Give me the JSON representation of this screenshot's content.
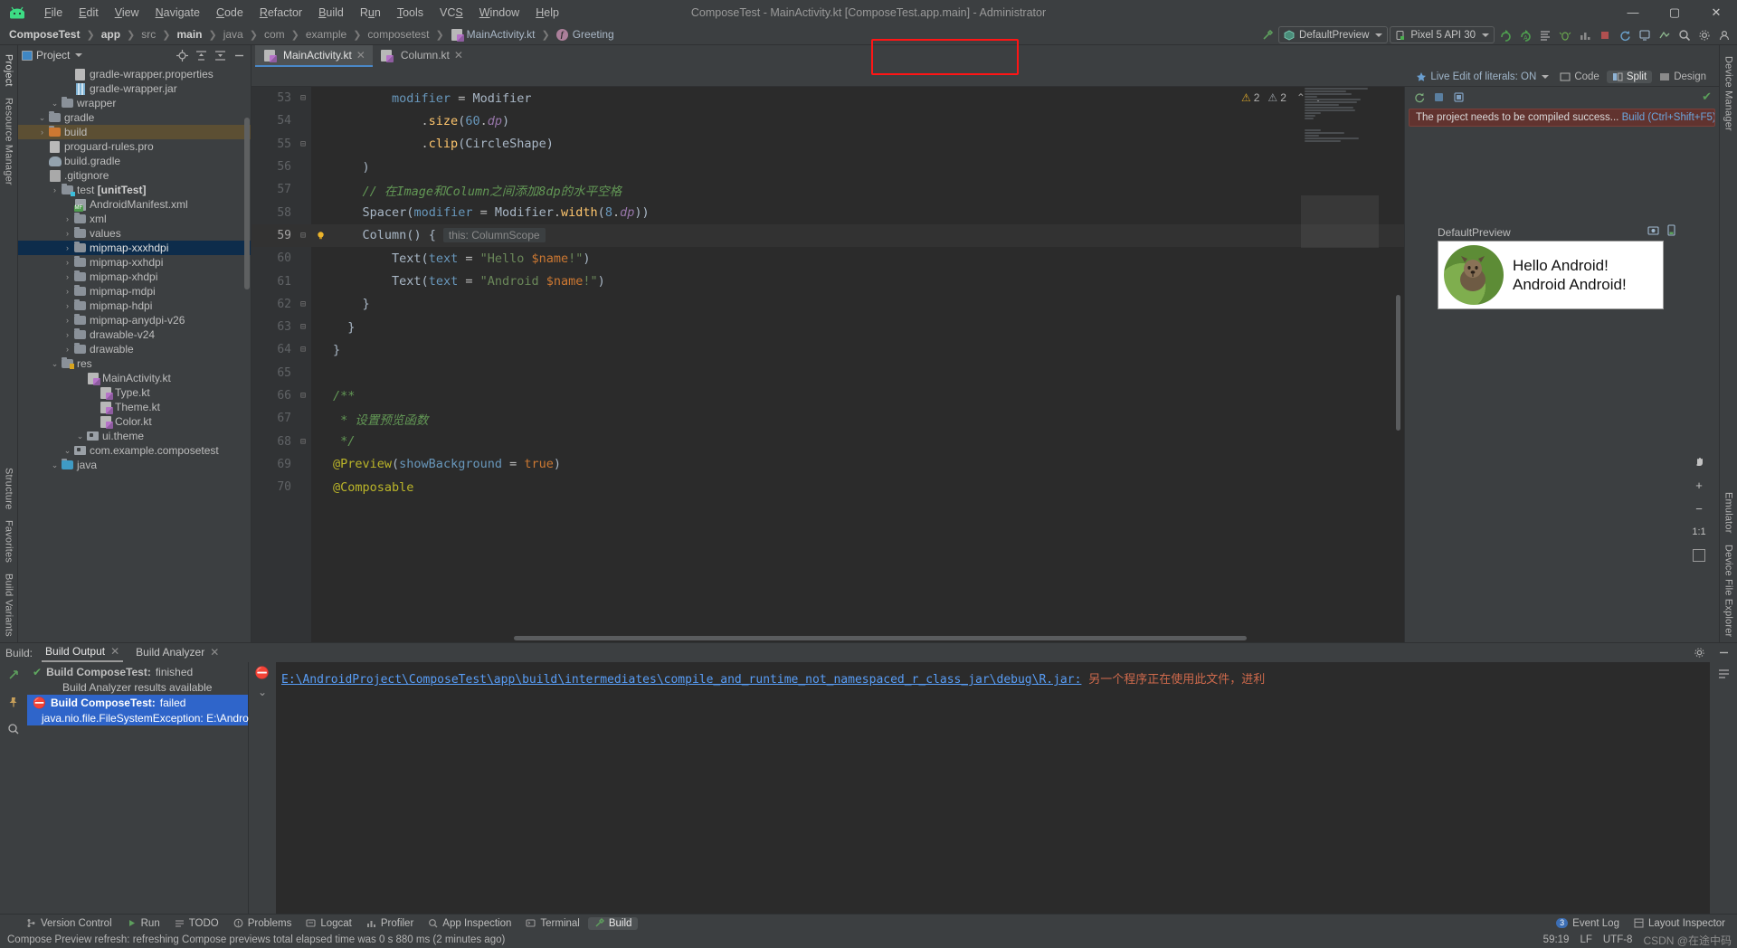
{
  "window": {
    "title": "ComposeTest - MainActivity.kt [ComposeTest.app.main] - Administrator",
    "minimize": "—",
    "maximize": "▢",
    "close": "✕"
  },
  "menu": [
    "File",
    "Edit",
    "View",
    "Navigate",
    "Code",
    "Refactor",
    "Build",
    "Run",
    "Tools",
    "VCS",
    "Window",
    "Help"
  ],
  "breadcrumb": [
    {
      "label": "ComposeTest",
      "style": "bold"
    },
    {
      "label": "app",
      "style": "bold"
    },
    {
      "label": "src",
      "style": "dim"
    },
    {
      "label": "main",
      "style": "bold"
    },
    {
      "label": "java",
      "style": "dim"
    },
    {
      "label": "com",
      "style": "dim"
    },
    {
      "label": "example",
      "style": "dim"
    },
    {
      "label": "composetest",
      "style": "dim"
    },
    {
      "label": "MainActivity.kt",
      "style": "file"
    },
    {
      "label": "Greeting",
      "style": "func"
    }
  ],
  "toolbar": {
    "run_config": "DefaultPreview",
    "device": "Pixel 5 API 30",
    "highlight_color": "#ff1515"
  },
  "project_panel": {
    "title": "Project",
    "tree": [
      {
        "indent": 2,
        "arrow": "v",
        "icon": "folder-blue",
        "label": "java"
      },
      {
        "indent": 3,
        "arrow": "v",
        "icon": "package",
        "label": "com.example.composetest"
      },
      {
        "indent": 4,
        "arrow": "v",
        "icon": "package",
        "label": "ui.theme"
      },
      {
        "indent": 5,
        "arrow": "",
        "icon": "kotlin",
        "label": "Color.kt"
      },
      {
        "indent": 5,
        "arrow": "",
        "icon": "kotlin",
        "label": "Theme.kt"
      },
      {
        "indent": 5,
        "arrow": "",
        "icon": "kotlin",
        "label": "Type.kt"
      },
      {
        "indent": 4,
        "arrow": "",
        "icon": "kotlin",
        "label": "MainActivity.kt"
      },
      {
        "indent": 2,
        "arrow": "v",
        "icon": "folder-res",
        "label": "res"
      },
      {
        "indent": 3,
        "arrow": ">",
        "icon": "folder",
        "label": "drawable"
      },
      {
        "indent": 3,
        "arrow": ">",
        "icon": "folder",
        "label": "drawable-v24"
      },
      {
        "indent": 3,
        "arrow": ">",
        "icon": "folder",
        "label": "mipmap-anydpi-v26"
      },
      {
        "indent": 3,
        "arrow": ">",
        "icon": "folder",
        "label": "mipmap-hdpi"
      },
      {
        "indent": 3,
        "arrow": ">",
        "icon": "folder",
        "label": "mipmap-mdpi"
      },
      {
        "indent": 3,
        "arrow": ">",
        "icon": "folder",
        "label": "mipmap-xhdpi"
      },
      {
        "indent": 3,
        "arrow": ">",
        "icon": "folder",
        "label": "mipmap-xxhdpi"
      },
      {
        "indent": 3,
        "arrow": ">",
        "icon": "folder",
        "label": "mipmap-xxxhdpi",
        "selected": true
      },
      {
        "indent": 3,
        "arrow": ">",
        "icon": "folder",
        "label": "values"
      },
      {
        "indent": 3,
        "arrow": ">",
        "icon": "folder",
        "label": "xml"
      },
      {
        "indent": 3,
        "arrow": "",
        "icon": "manifest",
        "label": "AndroidManifest.xml"
      },
      {
        "indent": 2,
        "arrow": ">",
        "icon": "folder-test",
        "label": "test [unitTest]",
        "bold_tail": "[unitTest]"
      },
      {
        "indent": 1,
        "arrow": "",
        "icon": "gitignore",
        "label": ".gitignore"
      },
      {
        "indent": 1,
        "arrow": "",
        "icon": "gradle",
        "label": "build.gradle"
      },
      {
        "indent": 1,
        "arrow": "",
        "icon": "prop",
        "label": "proguard-rules.pro"
      },
      {
        "indent": 1,
        "arrow": ">",
        "icon": "folder-orange",
        "label": "build",
        "highlight": true
      },
      {
        "indent": 1,
        "arrow": "v",
        "icon": "folder",
        "label": "gradle"
      },
      {
        "indent": 2,
        "arrow": "v",
        "icon": "folder",
        "label": "wrapper"
      },
      {
        "indent": 3,
        "arrow": "",
        "icon": "jar",
        "label": "gradle-wrapper.jar"
      },
      {
        "indent": 3,
        "arrow": "",
        "icon": "prop",
        "label": "gradle-wrapper.properties"
      }
    ]
  },
  "left_rail": [
    "Project",
    "Resource Manager",
    "Structure",
    "Favorites",
    "Build Variants"
  ],
  "right_rail": [
    "Device Manager",
    "Emulator",
    "Device File Explorer"
  ],
  "editor": {
    "tabs": [
      {
        "label": "MainActivity.kt",
        "active": true
      },
      {
        "label": "Column.kt",
        "active": false
      }
    ],
    "live_edit": "Live Edit of literals: ON",
    "view_modes": [
      {
        "label": "Code",
        "active": false
      },
      {
        "label": "Split",
        "active": true
      },
      {
        "label": "Design",
        "active": false
      }
    ],
    "warnings_count": "2",
    "errors_count": "2",
    "lines": [
      {
        "n": "53",
        "fold": "-",
        "code": "        modifier = Modifier"
      },
      {
        "n": "54",
        "fold": "",
        "code": "            .size(60.dp)"
      },
      {
        "n": "55",
        "fold": "-",
        "code": "            .clip(CircleShape)"
      },
      {
        "n": "56",
        "fold": "",
        "code": "    )"
      },
      {
        "n": "57",
        "fold": "",
        "code": "    // 在Image和Column之间添加8dp的水平空格"
      },
      {
        "n": "58",
        "fold": "",
        "code": "    Spacer(modifier = Modifier.width(8.dp))"
      },
      {
        "n": "59",
        "fold": "-",
        "code": "    Column() {",
        "hint": "this: ColumnScope",
        "bulb": true,
        "current": true
      },
      {
        "n": "60",
        "fold": "",
        "code": "        Text(text = \"Hello $name!\")"
      },
      {
        "n": "61",
        "fold": "",
        "code": "        Text(text = \"Android $name!\")"
      },
      {
        "n": "62",
        "fold": "-",
        "code": "    }"
      },
      {
        "n": "63",
        "fold": "-",
        "code": "  }"
      },
      {
        "n": "64",
        "fold": "-",
        "code": "}"
      },
      {
        "n": "65",
        "fold": "",
        "code": ""
      },
      {
        "n": "66",
        "fold": "-",
        "code": "/**"
      },
      {
        "n": "67",
        "fold": "",
        "code": " * 设置预览函数"
      },
      {
        "n": "68",
        "fold": "-",
        "code": " */"
      },
      {
        "n": "69",
        "fold": "",
        "code": "@Preview(showBackground = true)"
      },
      {
        "n": "70",
        "fold": "",
        "code": "@Composable"
      }
    ]
  },
  "preview": {
    "banner_text": "The project needs to be compiled success...",
    "banner_link": "Build (Ctrl+Shift+F5)",
    "label": "DefaultPreview",
    "text_line1": "Hello Android!",
    "text_line2": "Android Android!",
    "zoom_plus": "+",
    "zoom_minus": "−",
    "zoom_fit": "1:1"
  },
  "build_panel": {
    "label": "Build:",
    "tabs": [
      {
        "label": "Build Output",
        "active": true
      },
      {
        "label": "Build Analyzer",
        "active": false
      }
    ],
    "tree": [
      {
        "title": "Build ComposeTest:",
        "status": "finished",
        "icon": "check"
      },
      {
        "title": "Build Analyzer results available",
        "status": "",
        "icon": "none",
        "indent": true
      },
      {
        "title": "Build ComposeTest:",
        "status": "failed",
        "icon": "error",
        "selected": true
      },
      {
        "title": "java.nio.file.FileSystemException: E:\\Androi",
        "status": "",
        "icon": "none",
        "indent": true,
        "selected": true
      }
    ],
    "output_path": "E:\\AndroidProject\\ComposeTest\\app\\build\\intermediates\\compile_and_runtime_not_namespaced_r_class_jar\\debug\\R.jar:",
    "output_message": "另一个程序正在使用此文件，进利"
  },
  "bottom_tabs": [
    {
      "label": "Version Control",
      "icon": "branch-icon",
      "active": false
    },
    {
      "label": "Run",
      "icon": "play-icon",
      "active": false
    },
    {
      "label": "TODO",
      "icon": "list-icon",
      "active": false
    },
    {
      "label": "Problems",
      "icon": "warning-icon",
      "active": false
    },
    {
      "label": "Logcat",
      "icon": "logcat-icon",
      "active": false
    },
    {
      "label": "Profiler",
      "icon": "profiler-icon",
      "active": false
    },
    {
      "label": "App Inspection",
      "icon": "inspect-icon",
      "active": false
    },
    {
      "label": "Terminal",
      "icon": "terminal-icon",
      "active": false
    },
    {
      "label": "Build",
      "icon": "hammer-icon",
      "active": true
    }
  ],
  "bottom_tabs_right": [
    {
      "label": "Event Log",
      "badge": "3"
    },
    {
      "label": "Layout Inspector",
      "badge": ""
    }
  ],
  "status": {
    "message": "Compose Preview refresh: refreshing Compose previews total elapsed time was 0 s 880 ms (2 minutes ago)",
    "caret": "59:19",
    "line_sep": "LF",
    "encoding": "UTF-8",
    "watermark": "CSDN @在途中码"
  }
}
